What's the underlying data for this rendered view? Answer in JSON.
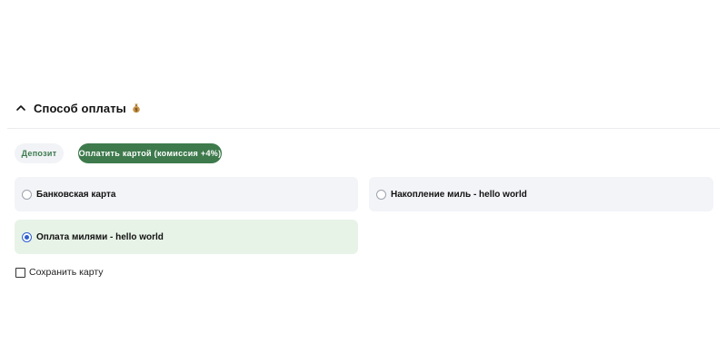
{
  "payment_section": {
    "title": "Способ оплаты",
    "expanded": true,
    "header_icon": "money-bag-icon",
    "tabs": [
      {
        "label": "Депозит",
        "active": false
      },
      {
        "label": "Оплатить картой (комиссия +4%)",
        "active": true
      }
    ],
    "options": [
      {
        "label": "Банковская карта",
        "selected": false
      },
      {
        "label": "Накопление миль - hello world",
        "selected": false
      },
      {
        "label": "Оплата милями - hello world",
        "selected": true
      }
    ],
    "save_card": {
      "label": "Сохранить карту",
      "checked": false
    }
  },
  "colors": {
    "accent_green": "#3e7a4c",
    "selected_bg": "#e8f3e8",
    "option_bg": "#f3f4f8",
    "radio_selected": "#2f5fd0"
  }
}
